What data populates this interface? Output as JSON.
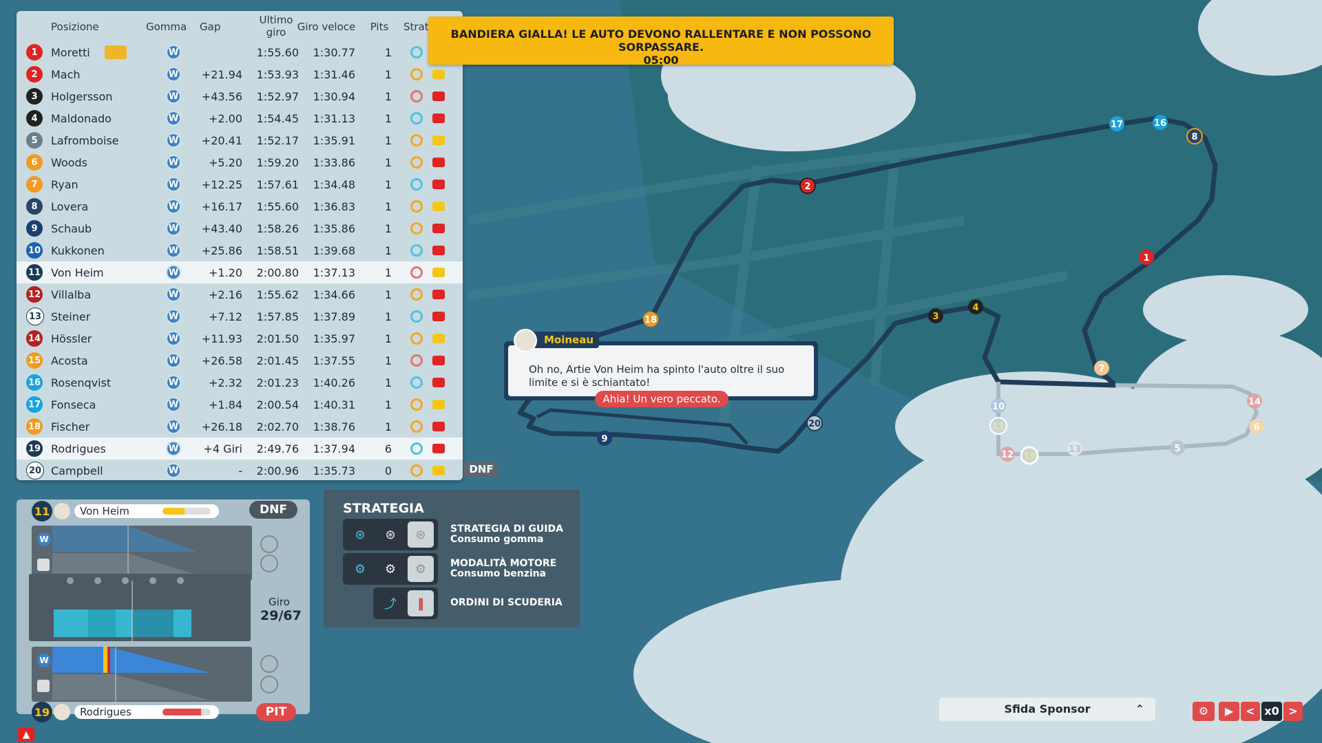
{
  "banner": {
    "title": "BANDIERA GIALLA! LE AUTO DEVONO RALLENTARE E NON POSSONO SORPASSARE.",
    "timer": "05:00"
  },
  "table": {
    "headers": {
      "position": "Posizione",
      "tyre": "Gomma",
      "gap": "Gap",
      "last_lap_1": "Ultimo",
      "last_lap_2": "giro",
      "fastest": "Giro veloce",
      "pits": "Pits",
      "strategy": "Strateg"
    },
    "rows": [
      {
        "pos": "1",
        "name": "Moretti",
        "tyre": "W",
        "gap": "",
        "last": "1:55.60",
        "fast": "1:30.77",
        "pits": "1",
        "color": "#e02424"
      },
      {
        "pos": "2",
        "name": "Mach",
        "tyre": "W",
        "gap": "+21.94",
        "last": "1:53.93",
        "fast": "1:31.46",
        "pits": "1",
        "color": "#e02424"
      },
      {
        "pos": "3",
        "name": "Holgersson",
        "tyre": "W",
        "gap": "+43.56",
        "last": "1:52.97",
        "fast": "1:30.94",
        "pits": "1",
        "color": "#222"
      },
      {
        "pos": "4",
        "name": "Maldonado",
        "tyre": "W",
        "gap": "+2.00",
        "last": "1:54.45",
        "fast": "1:31.13",
        "pits": "1",
        "color": "#222"
      },
      {
        "pos": "5",
        "name": "Lafromboise",
        "tyre": "W",
        "gap": "+20.41",
        "last": "1:52.17",
        "fast": "1:35.91",
        "pits": "1",
        "color": "#6d7f8f"
      },
      {
        "pos": "6",
        "name": "Woods",
        "tyre": "W",
        "gap": "+5.20",
        "last": "1:59.20",
        "fast": "1:33.86",
        "pits": "1",
        "color": "#f39a1f"
      },
      {
        "pos": "7",
        "name": "Ryan",
        "tyre": "W",
        "gap": "+12.25",
        "last": "1:57.61",
        "fast": "1:34.48",
        "pits": "1",
        "color": "#f39a1f"
      },
      {
        "pos": "8",
        "name": "Lovera",
        "tyre": "W",
        "gap": "+16.17",
        "last": "1:55.60",
        "fast": "1:36.83",
        "pits": "1",
        "color": "#2a4466"
      },
      {
        "pos": "9",
        "name": "Schaub",
        "tyre": "W",
        "gap": "+43.40",
        "last": "1:58.26",
        "fast": "1:35.86",
        "pits": "1",
        "color": "#1a3f70"
      },
      {
        "pos": "10",
        "name": "Kukkonen",
        "tyre": "W",
        "gap": "+25.86",
        "last": "1:58.51",
        "fast": "1:39.68",
        "pits": "1",
        "color": "#1b62b0"
      },
      {
        "pos": "11",
        "name": "Von Heim",
        "tyre": "W",
        "gap": "+1.20",
        "last": "2:00.80",
        "fast": "1:37.13",
        "pits": "1",
        "color": "#1c3a55"
      },
      {
        "pos": "12",
        "name": "Villalba",
        "tyre": "W",
        "gap": "+2.16",
        "last": "1:55.62",
        "fast": "1:34.66",
        "pits": "1",
        "color": "#b82020"
      },
      {
        "pos": "13",
        "name": "Steiner",
        "tyre": "W",
        "gap": "+7.12",
        "last": "1:57.85",
        "fast": "1:37.89",
        "pits": "1",
        "color": "#ffffff"
      },
      {
        "pos": "14",
        "name": "Hössler",
        "tyre": "W",
        "gap": "+11.93",
        "last": "2:01.50",
        "fast": "1:35.97",
        "pits": "1",
        "color": "#b82020"
      },
      {
        "pos": "15",
        "name": "Acosta",
        "tyre": "W",
        "gap": "+26.58",
        "last": "2:01.45",
        "fast": "1:37.55",
        "pits": "1",
        "color": "#f39a1f"
      },
      {
        "pos": "16",
        "name": "Rosenqvist",
        "tyre": "W",
        "gap": "+2.32",
        "last": "2:01.23",
        "fast": "1:40.26",
        "pits": "1",
        "color": "#1aa3e0"
      },
      {
        "pos": "17",
        "name": "Fonseca",
        "tyre": "W",
        "gap": "+1.84",
        "last": "2:00.54",
        "fast": "1:40.31",
        "pits": "1",
        "color": "#1aa3e0"
      },
      {
        "pos": "18",
        "name": "Fischer",
        "tyre": "W",
        "gap": "+26.18",
        "last": "2:02.70",
        "fast": "1:38.76",
        "pits": "1",
        "color": "#f39a1f"
      },
      {
        "pos": "19",
        "name": "Rodrigues",
        "tyre": "W",
        "gap": "+4 Giri",
        "last": "2:49.76",
        "fast": "1:37.94",
        "pits": "6",
        "color": "#1c3a55"
      },
      {
        "pos": "20",
        "name": "Campbell",
        "tyre": "W",
        "gap": "-",
        "last": "2:00.96",
        "fast": "1:35.73",
        "pits": "0",
        "color": "#ffffff"
      }
    ],
    "dnf_label": "DNF"
  },
  "dialog": {
    "speaker": "Moineau",
    "message": "Oh no, Artie Von Heim ha spinto l'auto oltre il suo limite e si è schiantato!",
    "reply": "Ahia! Un vero peccato."
  },
  "strategy": {
    "title": "STRATEGIA",
    "drive_title": "STRATEGIA DI GUIDA",
    "drive_sub": "Consumo gomma",
    "engine_title": "MODALITÀ MOTORE",
    "engine_sub": "Consumo benzina",
    "orders_title": "ORDINI DI SCUDERIA"
  },
  "driver1": {
    "number": "11",
    "name": "Von Heim",
    "status": "DNF",
    "tyre": "W",
    "energy_level": 0.45
  },
  "driver2": {
    "number": "19",
    "name": "Rodrigues",
    "status": "PIT",
    "tyre": "W",
    "energy_level": 0.8
  },
  "lap": {
    "label": "Giro",
    "value": "29/67"
  },
  "sponsor": {
    "label": "Sfida Sponsor"
  },
  "controls": {
    "speed": "x0",
    "prev": "<",
    "next": ">"
  },
  "colors": {
    "flag": "#f7b90f",
    "accent_red": "#e04a4a",
    "water": "#2f6e88"
  }
}
